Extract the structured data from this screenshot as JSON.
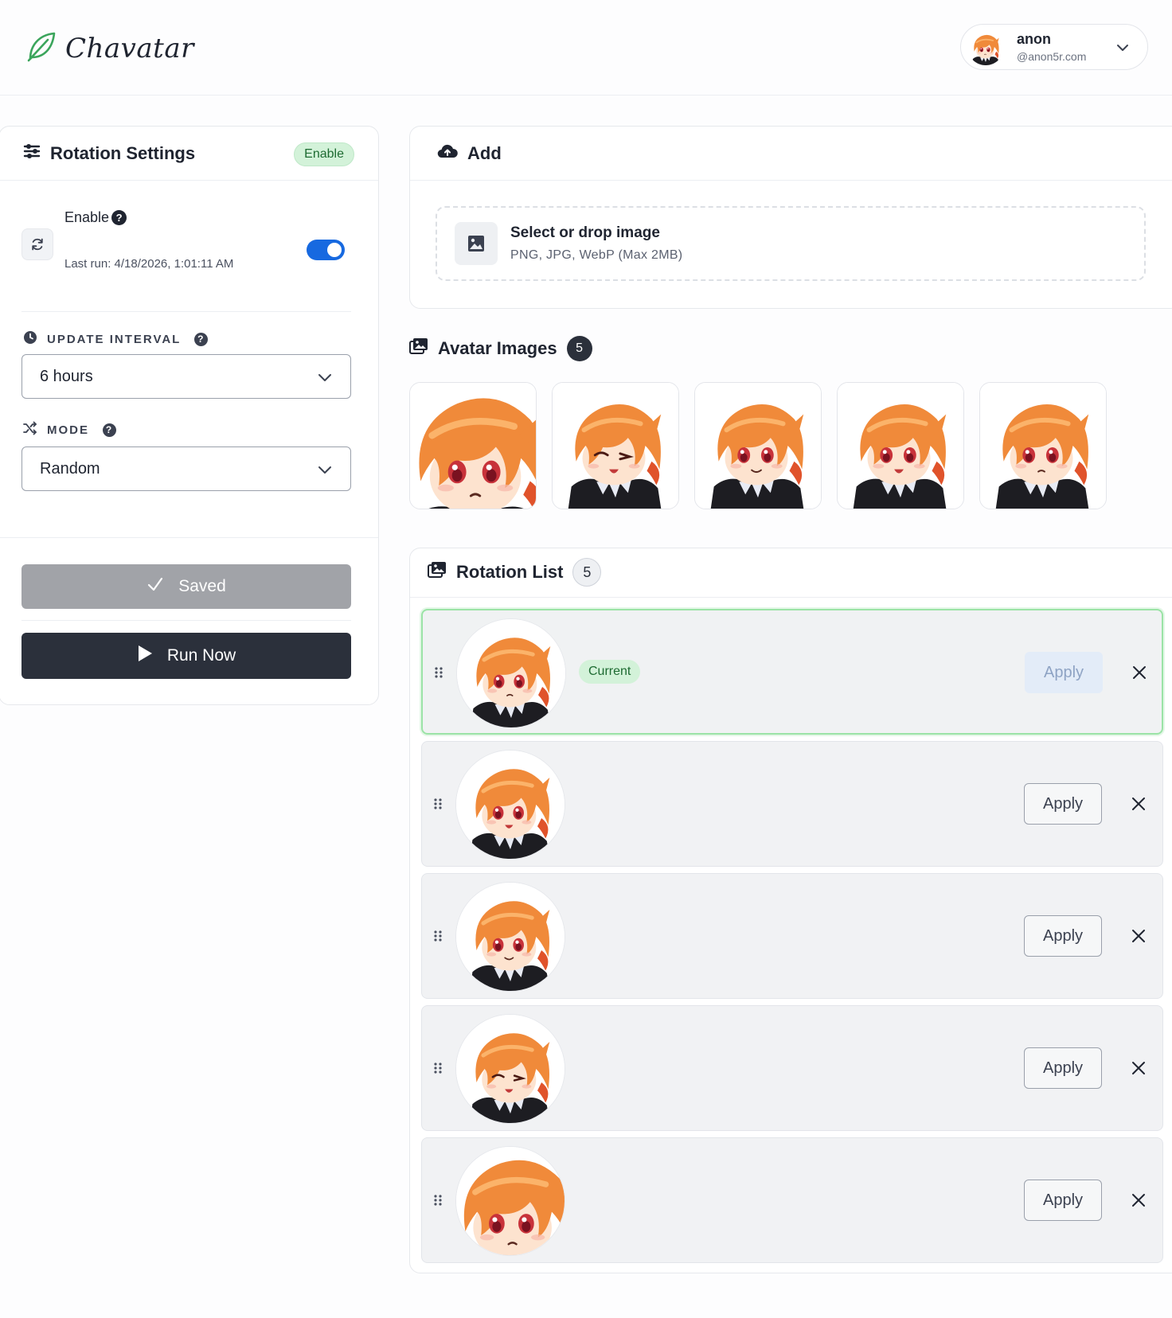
{
  "app": {
    "title": "Chavatar"
  },
  "user": {
    "name": "anon",
    "email": "@anon5r.com"
  },
  "colors": {
    "accent": "#1769e0",
    "success": "#1e6b32",
    "success_bg": "#d3f2d9",
    "dark": "#2b303b",
    "logo": "#3ba55c"
  },
  "settings": {
    "title": "Rotation Settings",
    "status_badge": "Enable",
    "enable_label": "Enable",
    "enabled": true,
    "last_run": "Last run: 4/18/2026, 1:01:11 AM",
    "interval_label": "UPDATE INTERVAL",
    "interval_value": "6 hours",
    "mode_label": "MODE",
    "mode_value": "Random",
    "saved_label": "Saved",
    "run_label": "Run Now"
  },
  "add": {
    "title": "Add",
    "drop_title": "Select or drop image",
    "drop_sub": "PNG, JPG, WebP (Max 2MB)"
  },
  "images": {
    "title": "Avatar Images",
    "count": "5",
    "items": [
      "closeup",
      "wink",
      "smile",
      "open-mouth",
      "neutral"
    ]
  },
  "rotation": {
    "title": "Rotation List",
    "count": "5",
    "current_label": "Current",
    "apply_label": "Apply",
    "rows": [
      "neutral",
      "open-mouth",
      "smile",
      "wink",
      "closeup"
    ]
  },
  "icons": [
    "leaf-icon",
    "chevron-down-icon",
    "sliders-icon",
    "refresh-icon",
    "help-icon",
    "clock-icon",
    "shuffle-icon",
    "check-icon",
    "play-icon",
    "cloud-upload-icon",
    "image-icon",
    "images-icon",
    "grip-icon",
    "close-icon"
  ]
}
